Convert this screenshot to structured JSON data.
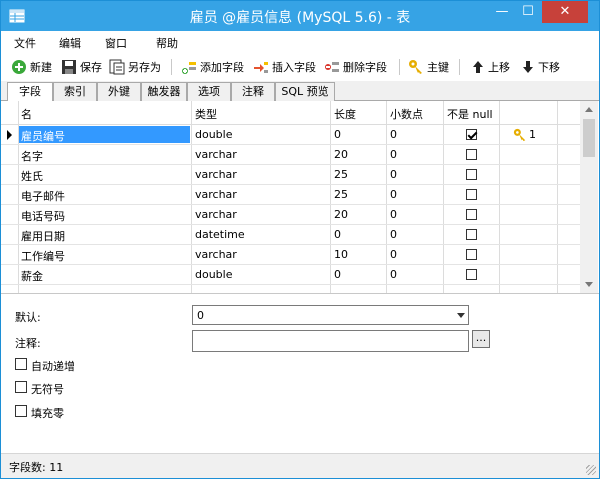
{
  "window": {
    "title": "雇员 @雇员信息 (MySQL 5.6) - 表",
    "minimize_glyph": "—",
    "maximize_glyph": "☐",
    "close_glyph": "✕"
  },
  "menu": {
    "items": [
      {
        "label": "文件"
      },
      {
        "label": "编辑"
      },
      {
        "label": "窗口"
      },
      {
        "label": "帮助"
      }
    ]
  },
  "toolbar": {
    "new_label": "新建",
    "save_label": "保存",
    "save_as_label": "另存为",
    "add_field_label": "添加字段",
    "insert_field_label": "插入字段",
    "delete_field_label": "删除字段",
    "primary_key_label": "主键",
    "move_up_label": "上移",
    "move_down_label": "下移"
  },
  "tabs": [
    {
      "label": "字段"
    },
    {
      "label": "索引"
    },
    {
      "label": "外键"
    },
    {
      "label": "触发器"
    },
    {
      "label": "选项"
    },
    {
      "label": "注释"
    },
    {
      "label": "SQL 预览"
    }
  ],
  "grid": {
    "columns": [
      "名",
      "类型",
      "长度",
      "小数点",
      "不是 null",
      ""
    ],
    "rows": [
      {
        "name": "雇员编号",
        "type": "double",
        "length": "0",
        "decimals": "0",
        "not_null": true,
        "key": "1"
      },
      {
        "name": "名字",
        "type": "varchar",
        "length": "20",
        "decimals": "0",
        "not_null": false,
        "key": ""
      },
      {
        "name": "姓氏",
        "type": "varchar",
        "length": "25",
        "decimals": "0",
        "not_null": false,
        "key": ""
      },
      {
        "name": "电子邮件",
        "type": "varchar",
        "length": "25",
        "decimals": "0",
        "not_null": false,
        "key": ""
      },
      {
        "name": "电话号码",
        "type": "varchar",
        "length": "20",
        "decimals": "0",
        "not_null": false,
        "key": ""
      },
      {
        "name": "雇用日期",
        "type": "datetime",
        "length": "0",
        "decimals": "0",
        "not_null": false,
        "key": ""
      },
      {
        "name": "工作编号",
        "type": "varchar",
        "length": "10",
        "decimals": "0",
        "not_null": false,
        "key": ""
      },
      {
        "name": "薪金",
        "type": "double",
        "length": "0",
        "decimals": "0",
        "not_null": false,
        "key": ""
      }
    ]
  },
  "properties": {
    "default_label": "默认:",
    "default_value": "0",
    "comment_label": "注释:",
    "comment_value": "",
    "ellipsis": "...",
    "auto_increment_label": "自动递增",
    "unsigned_label": "无符号",
    "zerofill_label": "填充零"
  },
  "status": {
    "field_count": "字段数: 11"
  },
  "colors": {
    "titlebar": "#36a3e5",
    "selection": "#3399ff",
    "close": "#c7413a",
    "key_gold": "#d9a400"
  }
}
